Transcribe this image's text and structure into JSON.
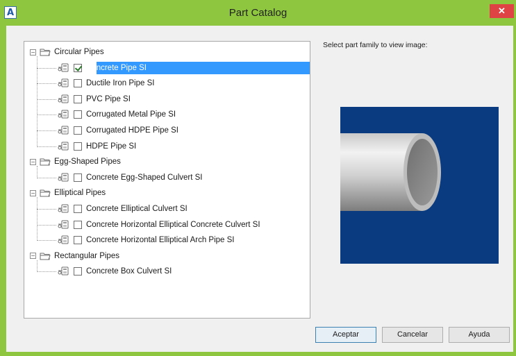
{
  "window": {
    "title": "Part Catalog",
    "close_label": "✕",
    "app_icon_glyph": "A"
  },
  "tree": {
    "groups": [
      {
        "label": "Circular Pipes",
        "items": [
          {
            "label": "Concrete Pipe SI",
            "checked": true,
            "selected": true
          },
          {
            "label": "Ductile Iron Pipe SI",
            "checked": false
          },
          {
            "label": "PVC Pipe SI",
            "checked": false
          },
          {
            "label": "Corrugated Metal Pipe SI",
            "checked": false
          },
          {
            "label": "Corrugated HDPE Pipe SI",
            "checked": false
          },
          {
            "label": "HDPE Pipe SI",
            "checked": false
          }
        ]
      },
      {
        "label": "Egg-Shaped Pipes",
        "items": [
          {
            "label": "Concrete Egg-Shaped Culvert SI",
            "checked": false
          }
        ]
      },
      {
        "label": "Elliptical Pipes",
        "items": [
          {
            "label": "Concrete Elliptical Culvert SI",
            "checked": false
          },
          {
            "label": "Concrete Horizontal Elliptical Concrete Culvert SI",
            "checked": false
          },
          {
            "label": "Concrete Horizontal Elliptical Arch Pipe SI",
            "checked": false
          }
        ]
      },
      {
        "label": "Rectangular Pipes",
        "items": [
          {
            "label": "Concrete Box Culvert SI",
            "checked": false
          }
        ]
      }
    ],
    "expander_glyph": "−"
  },
  "preview": {
    "label": "Select part family to view image:",
    "background_color": "#0a3b80"
  },
  "buttons": {
    "ok": "Aceptar",
    "cancel": "Cancelar",
    "help": "Ayuda"
  },
  "colors": {
    "frame": "#8ec63f",
    "selection": "#3399ff",
    "close": "#e04343"
  }
}
